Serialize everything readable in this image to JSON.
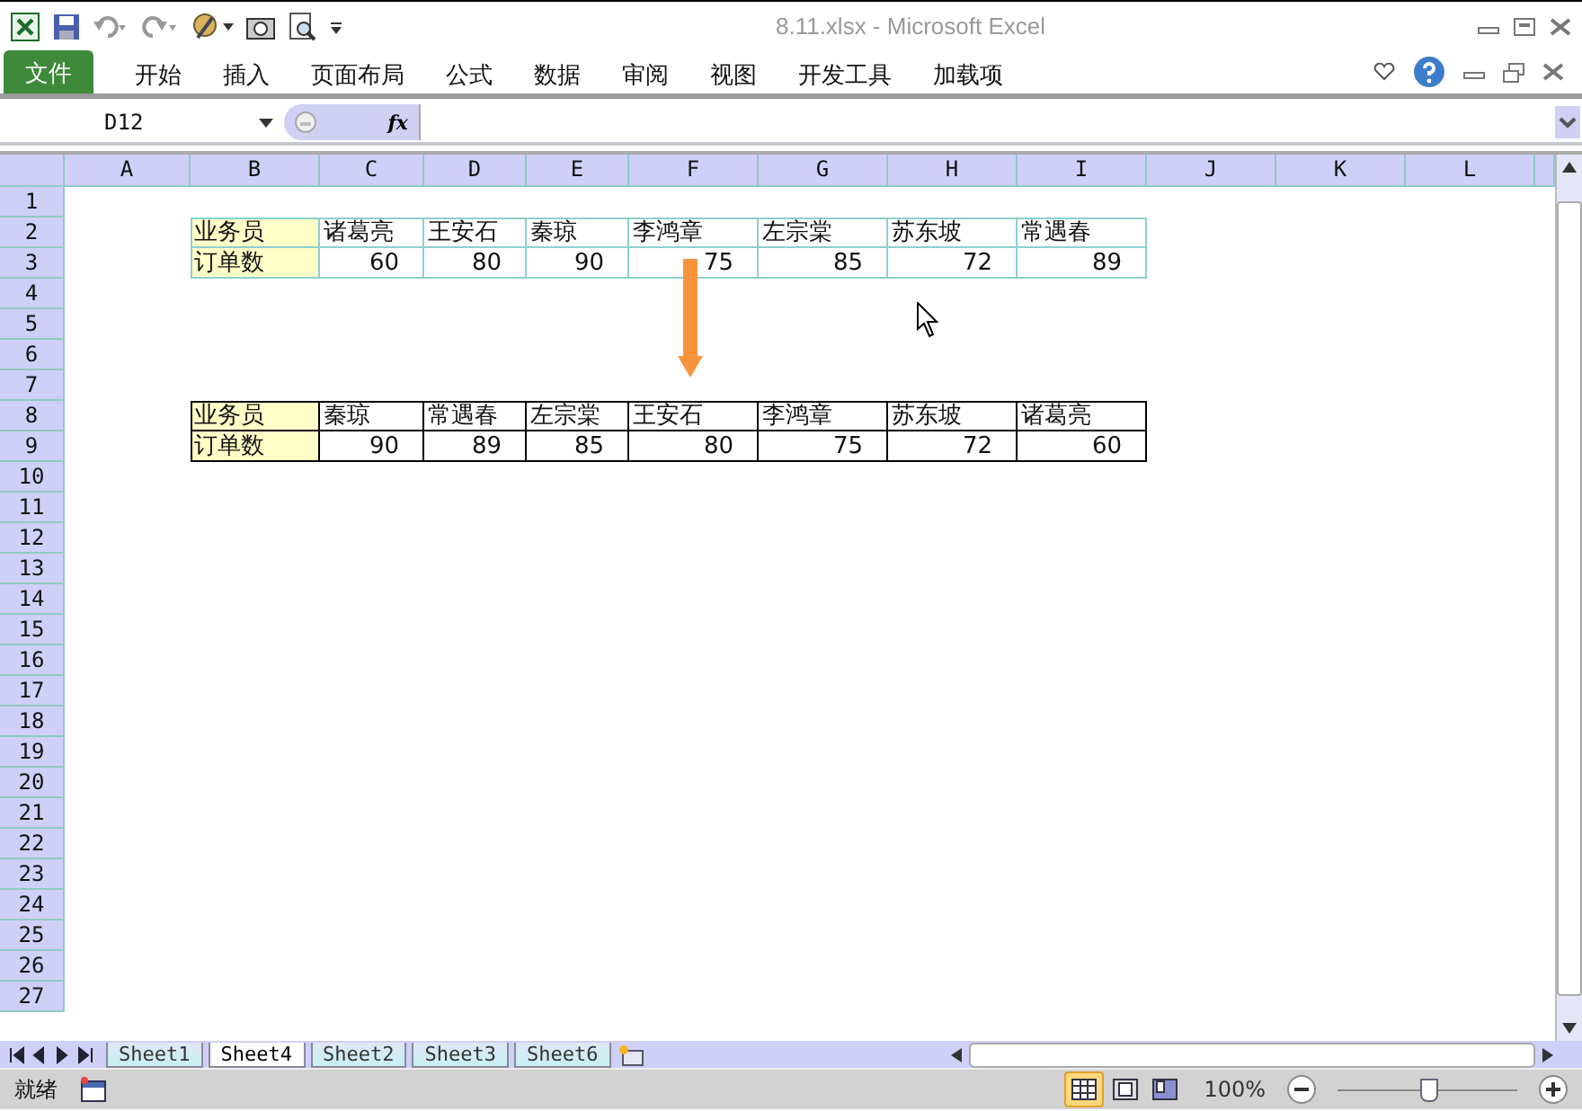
{
  "window": {
    "title": "8.11.xlsx  -  Microsoft Excel"
  },
  "ribbon_tabs": [
    {
      "label": "文件",
      "kind": "file",
      "selected": false
    },
    {
      "label": "开始",
      "kind": "tab",
      "selected": false
    },
    {
      "label": "插入",
      "kind": "tab",
      "selected": false
    },
    {
      "label": "页面布局",
      "kind": "tab",
      "selected": false
    },
    {
      "label": "公式",
      "kind": "tab",
      "selected": false
    },
    {
      "label": "数据",
      "kind": "tab",
      "selected": false
    },
    {
      "label": "审阅",
      "kind": "tab",
      "selected": false
    },
    {
      "label": "视图",
      "kind": "tab",
      "selected": false
    },
    {
      "label": "开发工具",
      "kind": "tab",
      "selected": false
    },
    {
      "label": "加载项",
      "kind": "tab",
      "selected": false
    }
  ],
  "formula_bar": {
    "name_box": "D12",
    "fx": "fx"
  },
  "sheet": {
    "columns": [
      "A",
      "B",
      "C",
      "D",
      "E",
      "F",
      "G",
      "H",
      "I",
      "J",
      "K",
      "L"
    ],
    "rows": [
      {
        "number": "1",
        "cells": []
      },
      {
        "number": "2",
        "color": "#8ccfcf",
        "cells": [
          {
            "text": "",
            "kind": "empty"
          },
          {
            "text": "业务员",
            "kind": "text",
            "highlighted": true
          },
          {
            "text": "诸葛亮",
            "kind": "text",
            "highlighted": false
          },
          {
            "text": "王安石",
            "kind": "text",
            "highlighted": false
          },
          {
            "text": "秦琼",
            "kind": "text",
            "highlighted": false
          },
          {
            "text": "李鸿章",
            "kind": "text",
            "highlighted": false
          },
          {
            "text": "左宗棠",
            "kind": "text",
            "highlighted": false
          },
          {
            "text": "苏东坡",
            "kind": "text",
            "highlighted": false
          },
          {
            "text": "常遇春",
            "kind": "text",
            "highlighted": false
          }
        ]
      },
      {
        "number": "3",
        "color": "#8ccfcf",
        "cells": [
          {
            "text": "",
            "kind": "empty"
          },
          {
            "text": "订单数",
            "kind": "text",
            "highlighted": true
          },
          {
            "text": "60",
            "kind": "number",
            "highlighted": false
          },
          {
            "text": "80",
            "kind": "number",
            "highlighted": false
          },
          {
            "text": "90",
            "kind": "number",
            "highlighted": false
          },
          {
            "text": "75",
            "kind": "number",
            "highlighted": false
          },
          {
            "text": "85",
            "kind": "number",
            "highlighted": false
          },
          {
            "text": "72",
            "kind": "number",
            "highlighted": false
          },
          {
            "text": "89",
            "kind": "number",
            "highlighted": false
          }
        ]
      },
      {
        "number": "4",
        "cells": []
      },
      {
        "number": "5",
        "cells": []
      },
      {
        "number": "6",
        "cells": []
      },
      {
        "number": "7",
        "cells": []
      },
      {
        "number": "8",
        "color": "#000000",
        "cells": [
          {
            "text": "",
            "kind": "empty"
          },
          {
            "text": "业务员",
            "kind": "text",
            "highlighted": true
          },
          {
            "text": "秦琼",
            "kind": "text",
            "highlighted": false
          },
          {
            "text": "常遇春",
            "kind": "text",
            "highlighted": false
          },
          {
            "text": "左宗棠",
            "kind": "text",
            "highlighted": false
          },
          {
            "text": "王安石",
            "kind": "text",
            "highlighted": false
          },
          {
            "text": "李鸿章",
            "kind": "text",
            "highlighted": false
          },
          {
            "text": "苏东坡",
            "kind": "text",
            "highlighted": false
          },
          {
            "text": "诸葛亮",
            "kind": "text",
            "highlighted": false
          }
        ]
      },
      {
        "number": "9",
        "color": "#000000",
        "cells": [
          {
            "text": "",
            "kind": "empty"
          },
          {
            "text": "订单数",
            "kind": "text",
            "highlighted": true
          },
          {
            "text": "90",
            "kind": "number",
            "highlighted": false
          },
          {
            "text": "89",
            "kind": "number",
            "highlighted": false
          },
          {
            "text": "85",
            "kind": "number",
            "highlighted": false
          },
          {
            "text": "80",
            "kind": "number",
            "highlighted": false
          },
          {
            "text": "75",
            "kind": "number",
            "highlighted": false
          },
          {
            "text": "72",
            "kind": "number",
            "highlighted": false
          },
          {
            "text": "60",
            "kind": "number",
            "highlighted": false
          }
        ]
      },
      {
        "number": "10",
        "cells": []
      },
      {
        "number": "11",
        "cells": []
      },
      {
        "number": "12",
        "cells": []
      },
      {
        "number": "13",
        "cells": []
      },
      {
        "number": "14",
        "cells": []
      },
      {
        "number": "15",
        "cells": []
      },
      {
        "number": "16",
        "cells": []
      },
      {
        "number": "17",
        "cells": []
      },
      {
        "number": "18",
        "cells": []
      },
      {
        "number": "19",
        "cells": []
      },
      {
        "number": "20",
        "cells": []
      },
      {
        "number": "21",
        "cells": []
      },
      {
        "number": "22",
        "cells": []
      },
      {
        "number": "23",
        "cells": []
      },
      {
        "number": "24",
        "cells": []
      },
      {
        "number": "25",
        "cells": []
      },
      {
        "number": "26",
        "cells": []
      },
      {
        "number": "27",
        "cells": []
      }
    ]
  },
  "sheet_tabs": [
    {
      "label": "Sheet1",
      "selected": false
    },
    {
      "label": "Sheet4",
      "selected": true
    },
    {
      "label": "Sheet2",
      "selected": false
    },
    {
      "label": "Sheet3",
      "selected": false
    },
    {
      "label": "Sheet6",
      "selected": false
    }
  ],
  "status_bar": {
    "status": "就绪",
    "views": [
      {
        "kind": "normal",
        "selected": true
      },
      {
        "kind": "layout",
        "selected": false
      },
      {
        "kind": "pagebreak",
        "selected": false
      }
    ],
    "zoom": "100%",
    "zoom_slider": {
      "level": 0.5
    }
  }
}
